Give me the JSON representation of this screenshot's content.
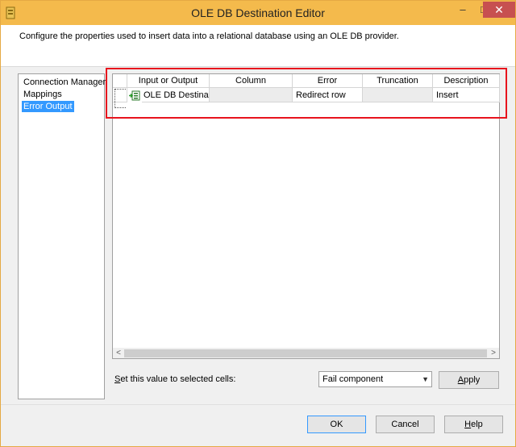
{
  "window": {
    "title": "OLE DB Destination Editor",
    "minimize_glyph": "–",
    "maximize_glyph": "□",
    "close_glyph": "✕"
  },
  "header": {
    "description": "Configure the properties used to insert data into a relational database using an OLE DB provider."
  },
  "nav": {
    "items": [
      {
        "label": "Connection Manager",
        "selected": false
      },
      {
        "label": "Mappings",
        "selected": false
      },
      {
        "label": "Error Output",
        "selected": true
      }
    ]
  },
  "grid": {
    "columns": [
      "Input or Output",
      "Column",
      "Error",
      "Truncation",
      "Description"
    ],
    "rows": [
      {
        "input_or_output": "OLE DB Destinati...",
        "column": "",
        "error": "Redirect row",
        "truncation": "",
        "description": "Insert"
      }
    ]
  },
  "scrollbar": {
    "left_glyph": "<",
    "right_glyph": ">"
  },
  "bottom": {
    "set_label_prefix": "S",
    "set_label_rest": "et this value to selected cells:",
    "selected_value": "Fail component",
    "dropdown_glyph": "▼",
    "apply_prefix": "A",
    "apply_rest": "pply"
  },
  "footer": {
    "ok_label": "OK",
    "cancel_label": "Cancel",
    "help_prefix": "H",
    "help_rest": "elp"
  },
  "colors": {
    "titlebar": "#f4ba4c",
    "selection": "#3399ff",
    "highlight_box": "#e8141d",
    "close_button": "#c75050"
  }
}
